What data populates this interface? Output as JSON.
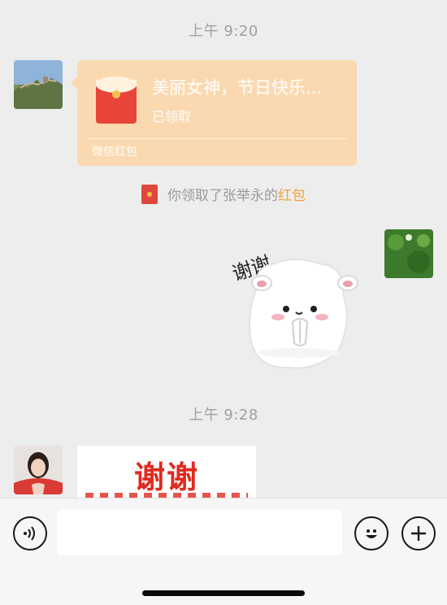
{
  "chat": {
    "timestamp_1": "上午 9:20",
    "timestamp_2": "上午 9:28",
    "red_packet": {
      "title": "美丽女神，节日快乐...",
      "status": "已领取",
      "footer": "微信红包"
    },
    "notice": {
      "prefix": "你领取了张举永的",
      "link": "红包"
    },
    "sticker": {
      "caption": "谢谢"
    },
    "image_message": {
      "text": "谢谢"
    }
  },
  "input_bar": {
    "voice_icon": "voice-icon",
    "emoji_icon": "emoji-icon",
    "plus_icon": "plus-icon",
    "text_value": ""
  },
  "colors": {
    "background": "#ededed",
    "red_packet": "#fbd9b0",
    "link": "#f2a23a",
    "accent_red": "#e02a1f"
  }
}
